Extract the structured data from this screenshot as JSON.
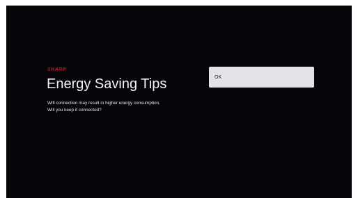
{
  "brand": {
    "logo_text": "SHARP",
    "color": "#e60012"
  },
  "dialog": {
    "title": "Energy Saving Tips",
    "message_line1": "Wifi connection may result in higher energy consumption.",
    "message_line2": "Will you keep it connected?"
  },
  "actions": {
    "ok_label": "OK"
  }
}
